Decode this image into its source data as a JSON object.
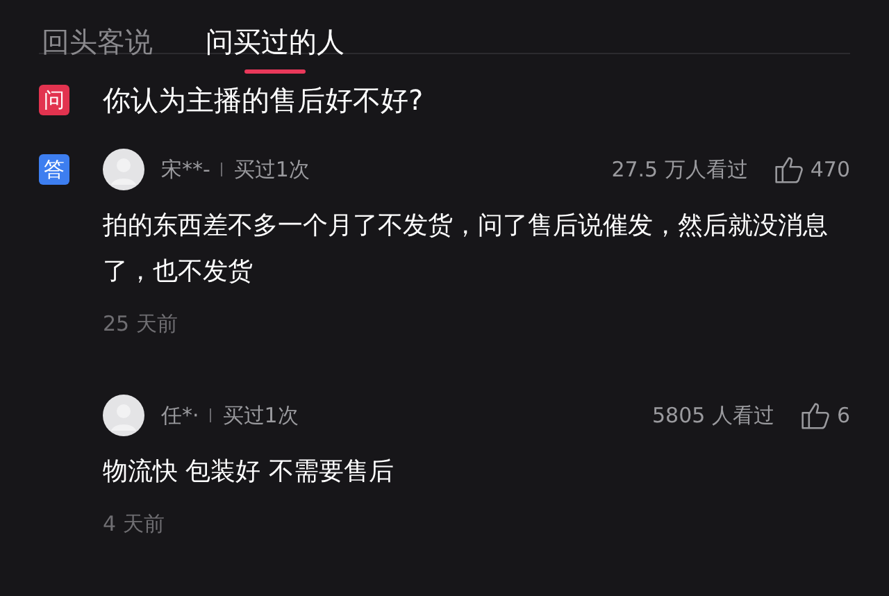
{
  "tabs": [
    {
      "label": "回头客说",
      "selected": false
    },
    {
      "label": "问买过的人",
      "selected": true
    }
  ],
  "question": {
    "badge": "问",
    "text": "你认为主播的售后好不好?"
  },
  "answers": [
    {
      "badge": "答",
      "name": "宋**-",
      "purchase": "买过1次",
      "views": "27.5 万人看过",
      "likes": "470",
      "text": "拍的东西差不多一个月了不发货，问了售后说催发，然后就没消息了，也不发货",
      "time": "25 天前"
    },
    {
      "name": "任*·",
      "purchase": "买过1次",
      "views": "5805 人看过",
      "likes": "6",
      "text": "物流快 包装好 不需要售后",
      "time": "4 天前"
    }
  ]
}
